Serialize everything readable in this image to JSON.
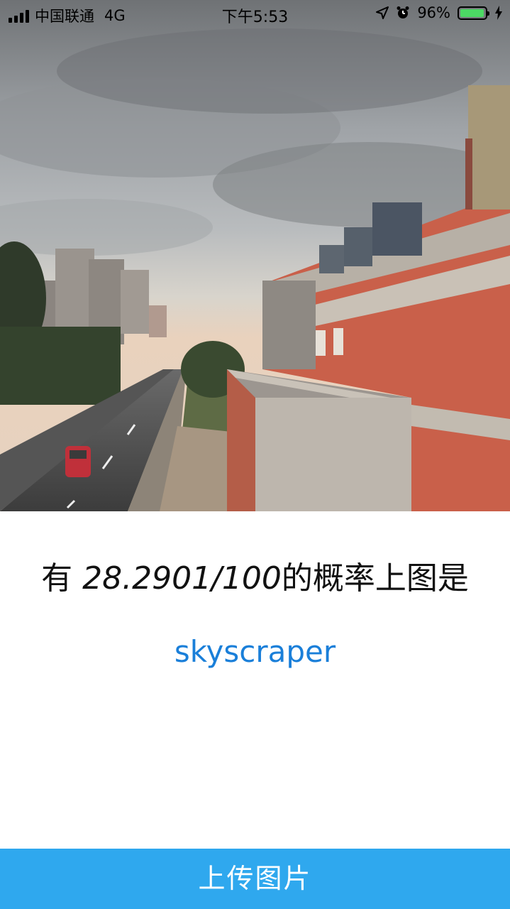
{
  "status_bar": {
    "carrier": "中国联通",
    "network": "4G",
    "time": "下午5:53",
    "battery_percent_text": "96%",
    "battery_level": 0.96,
    "icons": [
      "signal-bars-icon",
      "location-arrow-icon",
      "alarm-clock-icon",
      "battery-icon",
      "charging-bolt-icon"
    ]
  },
  "photo": {
    "subject": "city street with buildings under cloudy sky"
  },
  "result": {
    "prefix": "有 ",
    "probability": "28.2901/100",
    "suffix": "的概率上图是",
    "label": "skyscraper"
  },
  "upload_button": {
    "label": "上传图片"
  },
  "colors": {
    "accent": "#2fa8ee",
    "label_text": "#1a7fd9",
    "battery_green": "#4cd964"
  }
}
